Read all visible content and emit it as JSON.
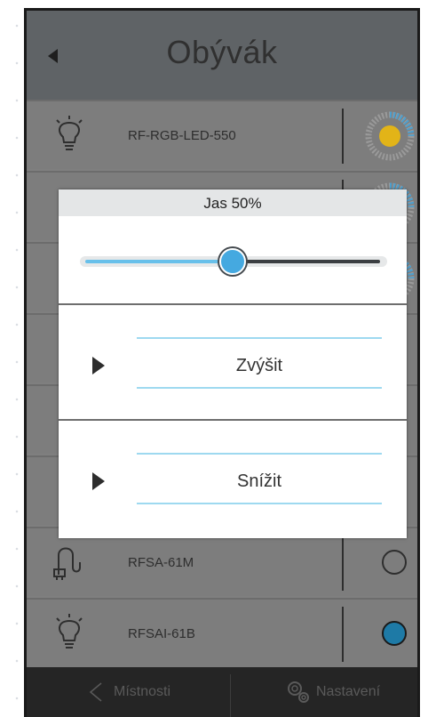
{
  "header": {
    "title": "Obývák"
  },
  "devices": [
    {
      "icon": "bulb-icon",
      "label": "RF-RGB-LED-550",
      "state": "dial"
    },
    {
      "icon": "bulb-icon",
      "label": "",
      "state": "dial"
    },
    {
      "icon": "bulb-icon",
      "label": "",
      "state": "dial"
    },
    {
      "icon": "",
      "label": "",
      "state": ""
    },
    {
      "icon": "",
      "label": "",
      "state": ""
    },
    {
      "icon": "",
      "label": "",
      "state": ""
    },
    {
      "icon": "plug-icon",
      "label": "RFSA-61M",
      "state": "off"
    },
    {
      "icon": "bulb-icon",
      "label": "RFSAI-61B",
      "state": "on"
    }
  ],
  "dialog": {
    "title": "Jas 50%",
    "brightness_percent": 50,
    "increase_label": "Zvýšit",
    "decrease_label": "Snížit"
  },
  "bottom_nav": {
    "rooms_label": "Místnosti",
    "settings_label": "Nastavení"
  },
  "colors": {
    "accent": "#45a9e0",
    "dial_yellow": "#e2b418",
    "state_on": "#1e7aa6"
  }
}
